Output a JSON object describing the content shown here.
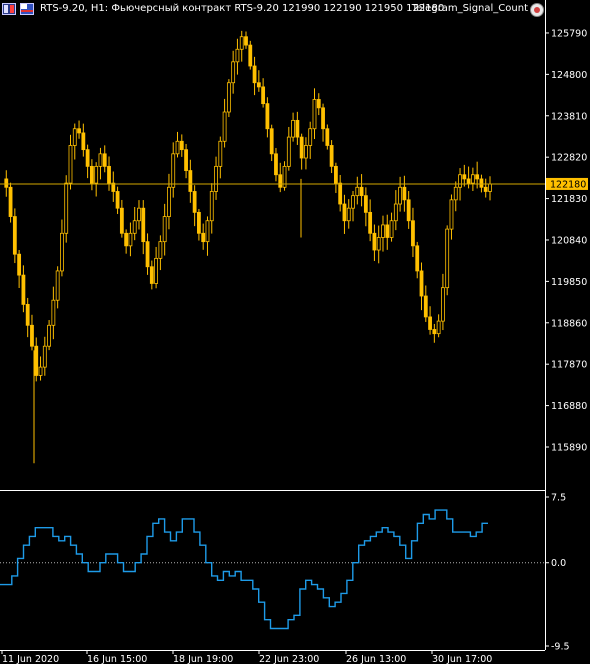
{
  "header": {
    "symbol_text": "RTS-9.20, H1:  Фьючерсный контракт RTS-9.20  121990 122190 121950 122180",
    "indicator_name": "Telegram_Signal_Count"
  },
  "colors": {
    "background": "#000000",
    "candle": "#ffc000",
    "candle_dark": "#b38600",
    "price_line": "#d4a800",
    "oscillator": "#1e9be8",
    "axis_text": "#ffffff",
    "frame": "#ffffff",
    "current_price_bg": "#ffc000",
    "current_price_text": "#000000"
  },
  "chart_data": [
    {
      "type": "candlestick",
      "y_ticks": [
        125790,
        124800,
        123810,
        122820,
        121830,
        120840,
        119850,
        118860,
        117870,
        116880,
        115890
      ],
      "ylim": [
        115340,
        126100
      ],
      "current_price": 122180,
      "x_tick_labels": [
        "11 Jun 2020",
        "16 Jun 15:00",
        "18 Jun 19:00",
        "22 Jun 23:00",
        "26 Jun 13:00",
        "30 Jun 17:00"
      ],
      "close_path": [
        122300,
        122100,
        121400,
        120500,
        120000,
        119300,
        118800,
        118300,
        117600,
        117800,
        118300,
        118800,
        119400,
        120100,
        121000,
        122200,
        123100,
        123500,
        123400,
        123000,
        122600,
        122200,
        122600,
        122900,
        122600,
        122200,
        122000,
        121600,
        121000,
        120700,
        121000,
        121300,
        121600,
        120800,
        120200,
        119800,
        120400,
        120800,
        121400,
        122100,
        122900,
        123200,
        123000,
        122500,
        122000,
        121500,
        121000,
        120800,
        121300,
        122000,
        122600,
        123200,
        123900,
        124600,
        125100,
        125400,
        125700,
        125500,
        125000,
        124600,
        124500,
        124100,
        123500,
        122900,
        122400,
        122100,
        122600,
        123300,
        123700,
        123300,
        122800,
        123100,
        123500,
        124200,
        124000,
        123500,
        123100,
        122600,
        122200,
        121700,
        121300,
        121600,
        121900,
        122100,
        121900,
        121500,
        121000,
        120600,
        120900,
        121200,
        120900,
        121300,
        121700,
        122100,
        121800,
        121300,
        120700,
        120100,
        119500,
        119000,
        118700,
        118600,
        118900,
        119700,
        121100,
        121800,
        122100,
        122400,
        122300,
        122200,
        122400,
        122300,
        122100,
        122000,
        122180
      ],
      "oscillator": {
        "ylim": [
          -9.5,
          7.5
        ],
        "y_ticks": [
          7.5,
          0.0,
          -9.5
        ],
        "steps": [
          -2.5,
          -2.5,
          -1.5,
          0.5,
          2.0,
          3.0,
          4.0,
          4.0,
          4.0,
          3.0,
          2.5,
          3.0,
          2.0,
          1.0,
          0.0,
          -1.0,
          -1.0,
          0.0,
          1.0,
          1.0,
          0.0,
          -1.0,
          -1.0,
          0.0,
          1.0,
          3.0,
          4.5,
          5.0,
          3.5,
          2.5,
          3.5,
          5.0,
          5.0,
          3.5,
          2.0,
          0.0,
          -1.5,
          -2.0,
          -1.0,
          -1.5,
          -1.0,
          -2.0,
          -2.0,
          -3.0,
          -4.5,
          -6.5,
          -7.5,
          -7.5,
          -7.5,
          -6.5,
          -6.0,
          -3.0,
          -2.0,
          -2.5,
          -3.0,
          -4.0,
          -5.0,
          -4.5,
          -3.5,
          -2.0,
          0.0,
          2.0,
          2.5,
          3.0,
          3.5,
          4.0,
          3.5,
          3.0,
          2.0,
          0.5,
          2.5,
          4.5,
          5.5,
          5.0,
          6.0,
          6.0,
          5.0,
          3.5,
          3.5,
          3.5,
          3.0,
          3.5,
          4.5
        ]
      }
    }
  ]
}
